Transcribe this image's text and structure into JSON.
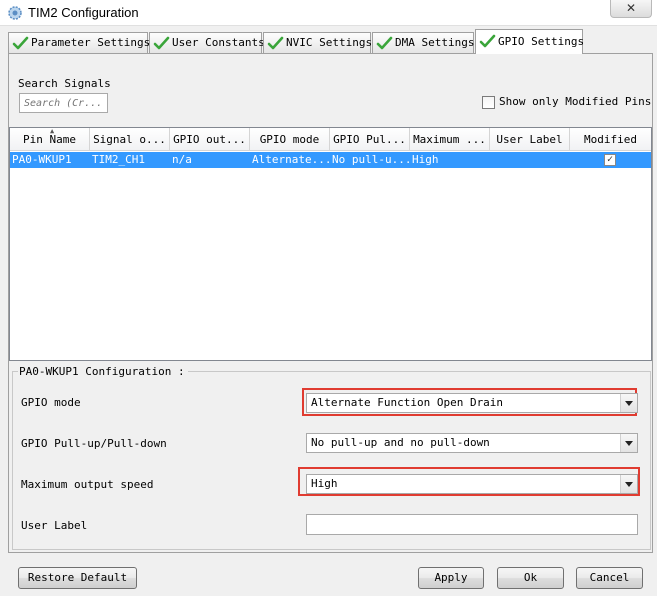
{
  "window": {
    "title": "TIM2 Configuration",
    "close_glyph": "✕"
  },
  "tabs": [
    {
      "label": "Parameter Settings",
      "icon": "checkmark-icon"
    },
    {
      "label": "User Constants",
      "icon": "checkmark-icon"
    },
    {
      "label": "NVIC Settings",
      "icon": "checkmark-icon"
    },
    {
      "label": "DMA Settings",
      "icon": "checkmark-icon"
    },
    {
      "label": "GPIO Settings",
      "icon": "checkmark-icon",
      "active": true
    }
  ],
  "search": {
    "label": "Search Signals",
    "placeholder": "Search (Cr..."
  },
  "show_modified": {
    "label": "Show only Modified Pins",
    "checked": false
  },
  "table": {
    "columns": [
      "Pin Name",
      "Signal o...",
      "GPIO out...",
      "GPIO mode",
      "GPIO Pul...",
      "Maximum ...",
      "User Label",
      "Modified"
    ],
    "rows": [
      {
        "pin": "PA0-WKUP1",
        "signal": "TIM2_CH1",
        "gpio_output": "n/a",
        "mode": "Alternate...",
        "pull": "No pull-u...",
        "speed": "High",
        "user_label": "",
        "modified": true,
        "modified_glyph": "✓"
      }
    ]
  },
  "config": {
    "title": "PA0-WKUP1 Configuration :",
    "gpio_mode": {
      "label": "GPIO mode",
      "value": "Alternate Function Open Drain"
    },
    "pull": {
      "label": "GPIO Pull-up/Pull-down",
      "value": "No pull-up and no pull-down"
    },
    "speed": {
      "label": "Maximum output speed",
      "value": "High"
    },
    "user_label": {
      "label": "User Label",
      "value": ""
    }
  },
  "buttons": {
    "restore": "Restore Default",
    "apply": "Apply",
    "ok": "Ok",
    "cancel": "Cancel"
  },
  "colors": {
    "selection": "#3399ff",
    "highlight_box": "#e03c31",
    "check_green": "#3aa53a"
  }
}
